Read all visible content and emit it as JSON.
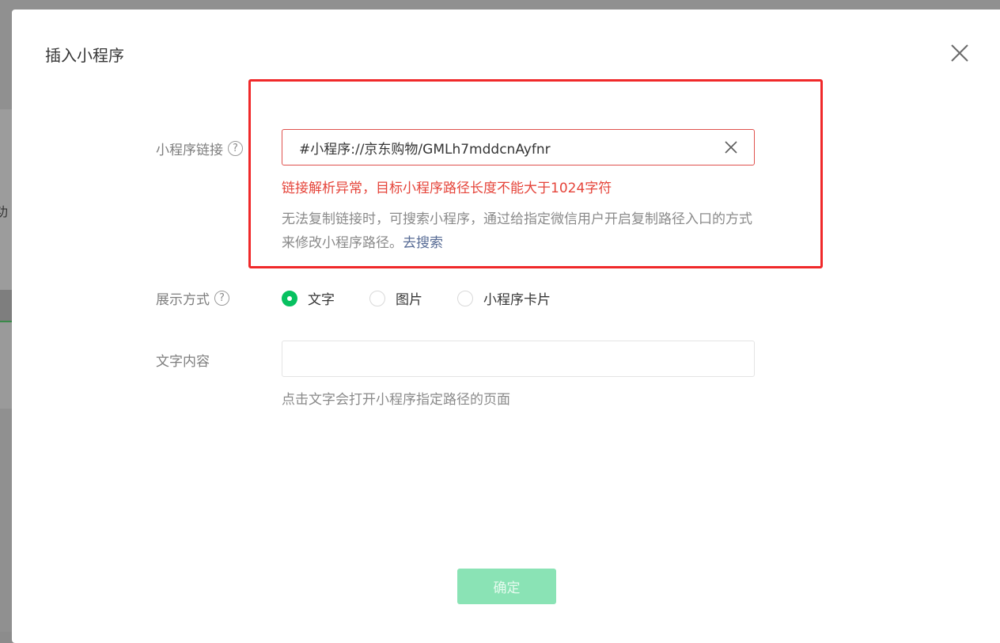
{
  "background": {
    "partial_text": "功"
  },
  "dialog": {
    "title": "插入小程序",
    "close_icon": "close-icon"
  },
  "link_field": {
    "label": "小程序链接",
    "help_icon": "?",
    "value": "#小程序://京东购物/GMLh7mddcnAyfnr",
    "error": "链接解析异常，目标小程序路径长度不能大于1024字符",
    "hint_text": "无法复制链接时，可搜索小程序，通过给指定微信用户开启复制路径入口的方式来修改小程序路径。",
    "hint_link": "去搜索"
  },
  "display_mode": {
    "label": "展示方式",
    "help_icon": "?",
    "options": [
      {
        "label": "文字",
        "checked": true
      },
      {
        "label": "图片",
        "checked": false
      },
      {
        "label": "小程序卡片",
        "checked": false
      }
    ]
  },
  "text_content": {
    "label": "文字内容",
    "value": "",
    "hint": "点击文字会打开小程序指定路径的页面"
  },
  "confirm_button": {
    "label": "确定",
    "enabled": false
  },
  "colors": {
    "accent": "#07c160",
    "error": "#e5443a",
    "link": "#576b95",
    "highlight_box": "#f0292a"
  }
}
